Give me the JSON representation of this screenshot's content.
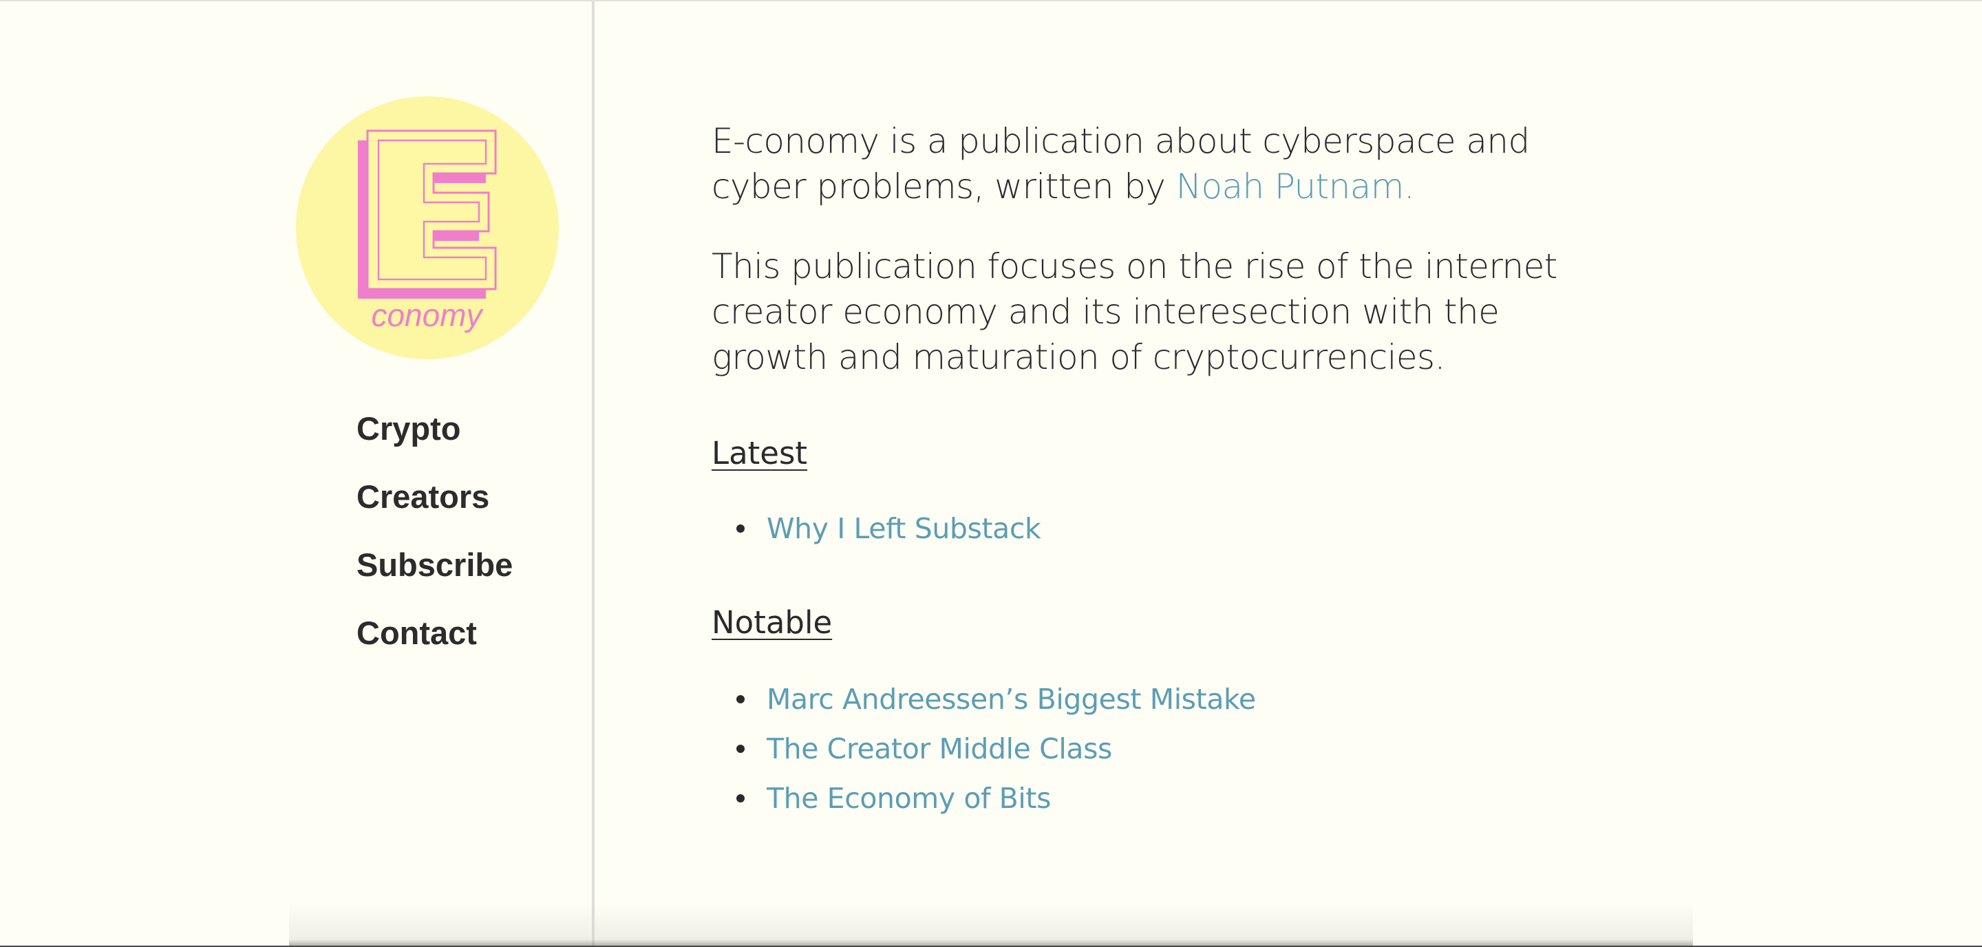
{
  "logo": {
    "letter": "E",
    "word": "conomy",
    "colors": {
      "circle": "#fdf6a3",
      "letter_fill": "#fef8a5",
      "shadow": "#ef7fca",
      "text": "#ef7fca"
    }
  },
  "nav": {
    "items": [
      {
        "label": "Crypto"
      },
      {
        "label": "Creators"
      },
      {
        "label": "Subscribe"
      },
      {
        "label": "Contact"
      }
    ]
  },
  "intro": {
    "line1_prefix": "E-conomy is a publication about cyberspace and cyber problems, written by ",
    "author_link": "Noah Putnam.",
    "line2": "This publication focuses on the rise of the internet creator economy and its interesection with the growth and maturation of cryptocurrencies."
  },
  "latest": {
    "heading": "Latest",
    "posts": [
      {
        "title": "Why I Left Substack"
      }
    ]
  },
  "notable": {
    "heading": "Notable",
    "posts": [
      {
        "title": "Marc Andreessen’s Biggest Mistake"
      },
      {
        "title": "The Creator Middle Class"
      },
      {
        "title": "The Economy of Bits"
      }
    ]
  },
  "colors": {
    "background": "#fefef5",
    "link": "#5b9db5",
    "text": "#2a2a2a"
  }
}
